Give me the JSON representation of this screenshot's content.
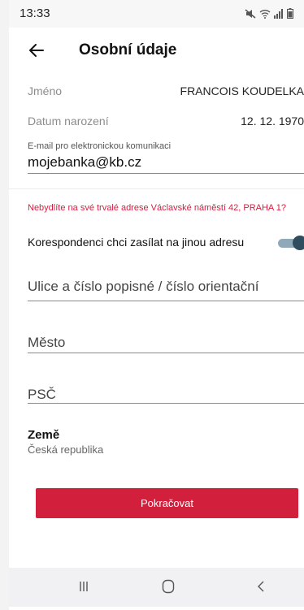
{
  "status_bar": {
    "time": "13:33",
    "icons": [
      "mute-icon",
      "wifi-icon",
      "signal-icon",
      "battery-icon"
    ]
  },
  "header": {
    "title": "Osobní údaje",
    "back_icon": "arrow-left-icon"
  },
  "personal": {
    "name_label": "Jméno",
    "name_value": "FRANCOIS  KOUDELKA",
    "birth_label": "Datum narození",
    "birth_value": "12. 12. 1970",
    "email_label": "E-mail pro elektronickou komunikaci",
    "email_value": "mojebanka@kb.cz"
  },
  "address": {
    "warning": "Nebydlíte na své trvalé adrese Václavské náměstí 42, PRAHA 1?",
    "toggle_label": "Korespondenci chci zasílat na jinou adresu",
    "toggle_on": true,
    "street_placeholder": "Ulice a číslo popisné / číslo orientační",
    "city_placeholder": "Město",
    "zip_placeholder": "PSČ",
    "country_label": "Země",
    "country_value": "Česká republika"
  },
  "actions": {
    "continue_label": "Pokračovat"
  },
  "colors": {
    "accent": "#d11f3c",
    "toggle_thumb": "#2f4d5e",
    "toggle_track": "#8fa9b8"
  },
  "nav_bar": {
    "icons": [
      "recents-icon",
      "home-icon",
      "back-icon"
    ]
  }
}
